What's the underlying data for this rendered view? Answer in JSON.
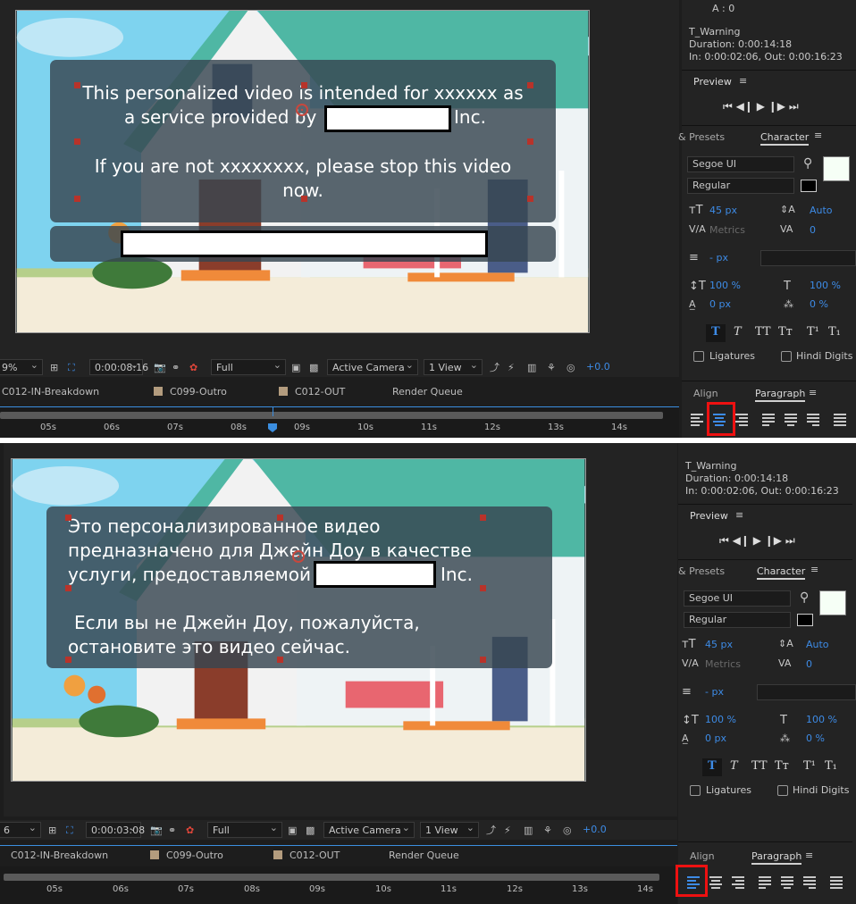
{
  "top": {
    "overlay_text": [
      "This personalized video is intended for xxxxxx as",
      "a service provided by",
      "Inc.",
      "If you are not xxxxxxxx, please stop this video",
      "now."
    ],
    "toolbar": {
      "zoom": "9%",
      "timecode": "0:00:08:16",
      "resolution": "Full",
      "camera": "Active Camera",
      "views": "1 View",
      "exposure": "+0.0"
    },
    "tabs": [
      "C012-IN-Breakdown",
      "C099-Outro",
      "C012-OUT",
      "Render Queue"
    ],
    "ruler": [
      "05s",
      "06s",
      "07s",
      "08s",
      "09s",
      "10s",
      "11s",
      "12s",
      "13s",
      "14s"
    ],
    "info": {
      "a_line": "A : 0",
      "layer": "T_Warning",
      "duration": "Duration: 0:00:14:18",
      "inout": "In: 0:00:02:06, Out: 0:00:16:23"
    }
  },
  "bottom": {
    "overlay_text": [
      "Это персонализированное видео",
      "предназначено для Джейн Доу в качестве",
      "услуги, предоставляемой",
      "Inc.",
      "Если вы не Джейн Доу, пожалуйста,",
      "остановите это видео сейчас."
    ],
    "toolbar": {
      "zoom": "6",
      "timecode": "0:00:03:08",
      "resolution": "Full",
      "camera": "Active Camera",
      "views": "1 View",
      "exposure": "+0.0"
    },
    "tabs": [
      "C012-IN-Breakdown",
      "C099-Outro",
      "C012-OUT",
      "Render Queue"
    ],
    "ruler": [
      "05s",
      "06s",
      "07s",
      "08s",
      "09s",
      "10s",
      "11s",
      "12s",
      "13s",
      "14s"
    ],
    "info": {
      "layer": "T_Warning",
      "duration": "Duration: 0:00:14:18",
      "inout": "In: 0:00:02:06, Out: 0:00:16:23"
    }
  },
  "panel": {
    "preview_title": "Preview",
    "presets_tab": "& Presets",
    "character_tab": "Character",
    "font_family": "Segoe UI",
    "font_style": "Regular",
    "font_size": "45 px",
    "leading": "Auto",
    "kerning": "Metrics",
    "tracking": "0",
    "stroke_width": "- px",
    "vscale": "100 %",
    "hscale": "100 %",
    "baseline": "0 px",
    "tsume": "0 %",
    "ligatures": "Ligatures",
    "hindi_digits": "Hindi Digits",
    "align_tab": "Align",
    "paragraph_tab": "Paragraph",
    "tt_buttons": [
      "T",
      "T",
      "TT",
      "Tт",
      "T¹",
      "T₁"
    ]
  },
  "colors": {
    "accent_blue": "#3d8be6",
    "highlight_red": "#e11111",
    "overlay": "#374650"
  }
}
